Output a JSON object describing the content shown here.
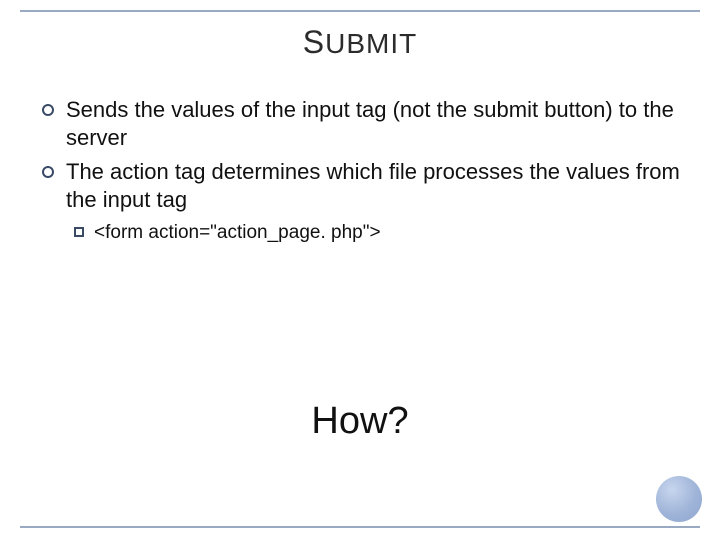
{
  "title": {
    "first": "S",
    "rest": "UBMIT"
  },
  "bullets": [
    "Sends the values of the input tag (not the submit button) to the server",
    "The action tag determines which file processes the values from the input tag"
  ],
  "sub": "<form action=\"action_page. php\">",
  "how": "How?"
}
